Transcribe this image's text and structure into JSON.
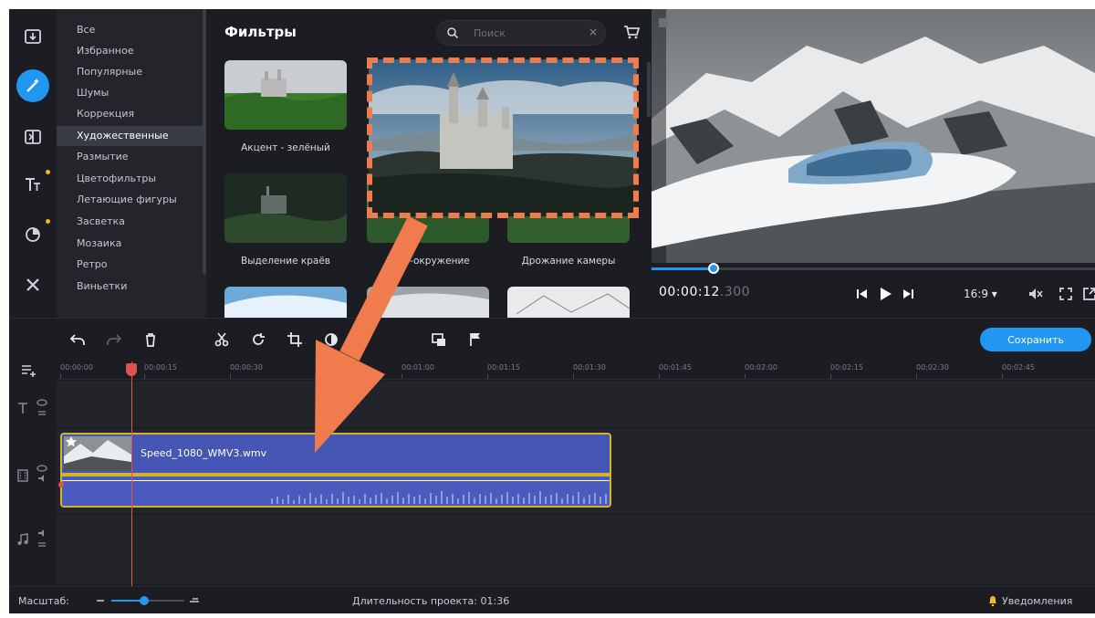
{
  "colors": {
    "accent": "#2196f3",
    "annotation": "#f07b4d",
    "clip": "#4656b5",
    "clip_border": "#d6b42a",
    "playhead": "#e0524e"
  },
  "rail": {
    "tools": [
      {
        "name": "import",
        "icon": "import-icon"
      },
      {
        "name": "filters",
        "icon": "magic-wand-icon",
        "active": true
      },
      {
        "name": "transitions",
        "icon": "transition-icon"
      },
      {
        "name": "titles",
        "icon": "titles-icon"
      },
      {
        "name": "stickers",
        "icon": "sticker-icon"
      },
      {
        "name": "more-tools",
        "icon": "tools-icon"
      }
    ]
  },
  "categories": {
    "items": [
      "Все",
      "Избранное",
      "Популярные",
      "Шумы",
      "Коррекция",
      "Художественные",
      "Размытие",
      "Цветофильтры",
      "Летающие фигуры",
      "Засветка",
      "Мозаика",
      "Ретро",
      "Виньетки"
    ],
    "selected": "Художественные"
  },
  "filters": {
    "title": "Фильтры",
    "search_placeholder": "Поиск",
    "search_clear": "×",
    "items": [
      {
        "label": "Акцент - зелёный"
      },
      {
        "label": "Выделение краёв"
      },
      {
        "label": "Гало-окружение"
      },
      {
        "label": "Дрожание камеры"
      }
    ]
  },
  "player": {
    "timecode": "00:00:12",
    "timecode_ms": ".300",
    "progress": 0.14,
    "aspect_ratio": "16:9 ▾"
  },
  "toolbar": {
    "save_label": "Сохранить",
    "icons": [
      "undo-icon",
      "redo-icon",
      "delete-icon",
      "cut-icon",
      "rotate-icon",
      "crop-icon",
      "color-icon",
      "pip-icon",
      "marker-icon"
    ]
  },
  "timeline": {
    "ruler": [
      "00:00:00",
      "00:00:15",
      "00:00:30",
      "00:00:45",
      "00:01:00",
      "00:01:15",
      "00:01:30",
      "00:01:45",
      "00:02:00",
      "00:02:15",
      "00:02:30",
      "00:02:45"
    ],
    "clip_name": "Speed_1080_WMV3.wmv"
  },
  "status": {
    "zoom_label": "Масштаб:",
    "zoom_level": 0.45,
    "duration_label": "Длительность проекта: 01:36",
    "notifications_label": "Уведомления"
  }
}
